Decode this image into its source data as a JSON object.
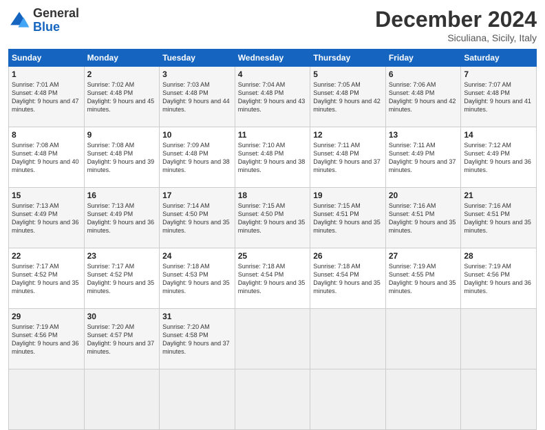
{
  "header": {
    "logo": {
      "general": "General",
      "blue": "Blue"
    },
    "title": "December 2024",
    "subtitle": "Siculiana, Sicily, Italy"
  },
  "calendar": {
    "days_of_week": [
      "Sunday",
      "Monday",
      "Tuesday",
      "Wednesday",
      "Thursday",
      "Friday",
      "Saturday"
    ],
    "weeks": [
      [
        null,
        null,
        null,
        null,
        null,
        null,
        null
      ]
    ],
    "cells": [
      {
        "day": 1,
        "sunrise": "7:01 AM",
        "sunset": "4:48 PM",
        "daylight": "9 hours and 47 minutes.",
        "col": 0
      },
      {
        "day": 2,
        "sunrise": "7:02 AM",
        "sunset": "4:48 PM",
        "daylight": "9 hours and 45 minutes.",
        "col": 1
      },
      {
        "day": 3,
        "sunrise": "7:03 AM",
        "sunset": "4:48 PM",
        "daylight": "9 hours and 44 minutes.",
        "col": 2
      },
      {
        "day": 4,
        "sunrise": "7:04 AM",
        "sunset": "4:48 PM",
        "daylight": "9 hours and 43 minutes.",
        "col": 3
      },
      {
        "day": 5,
        "sunrise": "7:05 AM",
        "sunset": "4:48 PM",
        "daylight": "9 hours and 42 minutes.",
        "col": 4
      },
      {
        "day": 6,
        "sunrise": "7:06 AM",
        "sunset": "4:48 PM",
        "daylight": "9 hours and 42 minutes.",
        "col": 5
      },
      {
        "day": 7,
        "sunrise": "7:07 AM",
        "sunset": "4:48 PM",
        "daylight": "9 hours and 41 minutes.",
        "col": 6
      },
      {
        "day": 8,
        "sunrise": "7:08 AM",
        "sunset": "4:48 PM",
        "daylight": "9 hours and 40 minutes.",
        "col": 0
      },
      {
        "day": 9,
        "sunrise": "7:08 AM",
        "sunset": "4:48 PM",
        "daylight": "9 hours and 39 minutes.",
        "col": 1
      },
      {
        "day": 10,
        "sunrise": "7:09 AM",
        "sunset": "4:48 PM",
        "daylight": "9 hours and 38 minutes.",
        "col": 2
      },
      {
        "day": 11,
        "sunrise": "7:10 AM",
        "sunset": "4:48 PM",
        "daylight": "9 hours and 38 minutes.",
        "col": 3
      },
      {
        "day": 12,
        "sunrise": "7:11 AM",
        "sunset": "4:48 PM",
        "daylight": "9 hours and 37 minutes.",
        "col": 4
      },
      {
        "day": 13,
        "sunrise": "7:11 AM",
        "sunset": "4:49 PM",
        "daylight": "9 hours and 37 minutes.",
        "col": 5
      },
      {
        "day": 14,
        "sunrise": "7:12 AM",
        "sunset": "4:49 PM",
        "daylight": "9 hours and 36 minutes.",
        "col": 6
      },
      {
        "day": 15,
        "sunrise": "7:13 AM",
        "sunset": "4:49 PM",
        "daylight": "9 hours and 36 minutes.",
        "col": 0
      },
      {
        "day": 16,
        "sunrise": "7:13 AM",
        "sunset": "4:49 PM",
        "daylight": "9 hours and 36 minutes.",
        "col": 1
      },
      {
        "day": 17,
        "sunrise": "7:14 AM",
        "sunset": "4:50 PM",
        "daylight": "9 hours and 35 minutes.",
        "col": 2
      },
      {
        "day": 18,
        "sunrise": "7:15 AM",
        "sunset": "4:50 PM",
        "daylight": "9 hours and 35 minutes.",
        "col": 3
      },
      {
        "day": 19,
        "sunrise": "7:15 AM",
        "sunset": "4:51 PM",
        "daylight": "9 hours and 35 minutes.",
        "col": 4
      },
      {
        "day": 20,
        "sunrise": "7:16 AM",
        "sunset": "4:51 PM",
        "daylight": "9 hours and 35 minutes.",
        "col": 5
      },
      {
        "day": 21,
        "sunrise": "7:16 AM",
        "sunset": "4:51 PM",
        "daylight": "9 hours and 35 minutes.",
        "col": 6
      },
      {
        "day": 22,
        "sunrise": "7:17 AM",
        "sunset": "4:52 PM",
        "daylight": "9 hours and 35 minutes.",
        "col": 0
      },
      {
        "day": 23,
        "sunrise": "7:17 AM",
        "sunset": "4:52 PM",
        "daylight": "9 hours and 35 minutes.",
        "col": 1
      },
      {
        "day": 24,
        "sunrise": "7:18 AM",
        "sunset": "4:53 PM",
        "daylight": "9 hours and 35 minutes.",
        "col": 2
      },
      {
        "day": 25,
        "sunrise": "7:18 AM",
        "sunset": "4:54 PM",
        "daylight": "9 hours and 35 minutes.",
        "col": 3
      },
      {
        "day": 26,
        "sunrise": "7:18 AM",
        "sunset": "4:54 PM",
        "daylight": "9 hours and 35 minutes.",
        "col": 4
      },
      {
        "day": 27,
        "sunrise": "7:19 AM",
        "sunset": "4:55 PM",
        "daylight": "9 hours and 35 minutes.",
        "col": 5
      },
      {
        "day": 28,
        "sunrise": "7:19 AM",
        "sunset": "4:56 PM",
        "daylight": "9 hours and 36 minutes.",
        "col": 6
      },
      {
        "day": 29,
        "sunrise": "7:19 AM",
        "sunset": "4:56 PM",
        "daylight": "9 hours and 36 minutes.",
        "col": 0
      },
      {
        "day": 30,
        "sunrise": "7:20 AM",
        "sunset": "4:57 PM",
        "daylight": "9 hours and 37 minutes.",
        "col": 1
      },
      {
        "day": 31,
        "sunrise": "7:20 AM",
        "sunset": "4:58 PM",
        "daylight": "9 hours and 37 minutes.",
        "col": 2
      }
    ]
  }
}
